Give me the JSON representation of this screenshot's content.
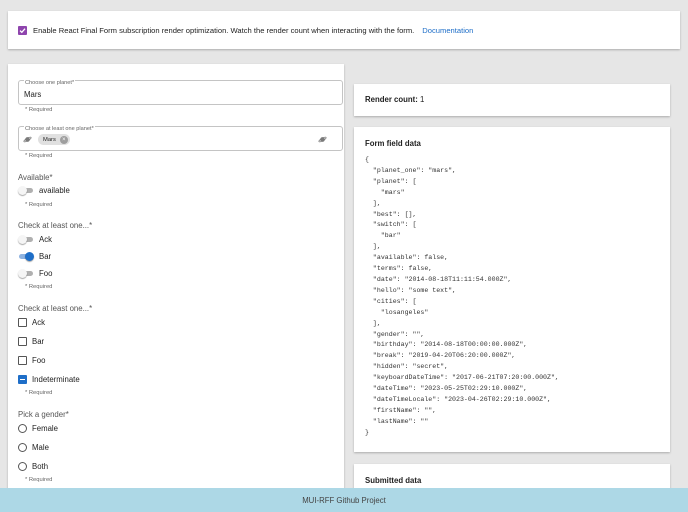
{
  "top": {
    "optimization_label": "Enable React Final Form subscription render optimization. Watch the render count when interacting with the form.",
    "documentation_link": "Documentation",
    "optimization_checked": true
  },
  "form": {
    "planet_one": {
      "label": "Choose one planet",
      "required_mark": "*",
      "value": "Mars",
      "helper": "* Required"
    },
    "planet": {
      "label": "Choose at least one planet",
      "required_mark": "*",
      "chip": "Mars",
      "helper": "* Required"
    },
    "available": {
      "label": "Available",
      "required_mark": "*",
      "switch_label": "available",
      "on": false,
      "helper": "* Required"
    },
    "switches": {
      "label": "Check at least one...",
      "required_mark": "*",
      "items": [
        {
          "label": "Ack",
          "on": false
        },
        {
          "label": "Bar",
          "on": true
        },
        {
          "label": "Foo",
          "on": false
        }
      ],
      "helper": "* Required"
    },
    "checkboxes": {
      "label": "Check at least one...",
      "required_mark": "*",
      "items": [
        {
          "label": "Ack",
          "state": "unchecked"
        },
        {
          "label": "Bar",
          "state": "unchecked"
        },
        {
          "label": "Foo",
          "state": "unchecked"
        },
        {
          "label": "Indeterminate",
          "state": "indeterminate"
        }
      ],
      "helper": "* Required"
    },
    "gender": {
      "label": "Pick a gender",
      "required_mark": "*",
      "options": [
        "Female",
        "Male",
        "Both"
      ],
      "helper": "* Required"
    }
  },
  "render_count": {
    "label": "Render count:",
    "value": "1"
  },
  "form_field_data": {
    "title": "Form field data",
    "json_text": "{\n  \"planet_one\": \"mars\",\n  \"planet\": [\n    \"mars\"\n  ],\n  \"best\": [],\n  \"switch\": [\n    \"bar\"\n  ],\n  \"available\": false,\n  \"terms\": false,\n  \"date\": \"2014-08-18T11:11:54.000Z\",\n  \"hello\": \"some text\",\n  \"cities\": [\n    \"losangeles\"\n  ],\n  \"gender\": \"\",\n  \"birthday\": \"2014-08-18T00:00:00.000Z\",\n  \"break\": \"2019-04-20T06:20:00.000Z\",\n  \"hidden\": \"secret\",\n  \"keyboardDateTime\": \"2017-06-21T07:20:00.000Z\",\n  \"dateTime\": \"2023-05-25T02:29:10.000Z\",\n  \"dateTimeLocale\": \"2023-04-26T02:29:10.000Z\",\n  \"firstName\": \"\",\n  \"lastName\": \"\"\n}"
  },
  "submitted_data": {
    "title": "Submitted data"
  },
  "footer": {
    "text": "MUI-RFF Github Project"
  },
  "colors": {
    "accent": "#1e6ec8",
    "checkbox": "#8e44ad",
    "footer_bg": "#add8e6"
  },
  "icons": {
    "planet_start": "planet-icon",
    "planet_end": "planet-icon",
    "chip_delete": "cancel-icon"
  }
}
